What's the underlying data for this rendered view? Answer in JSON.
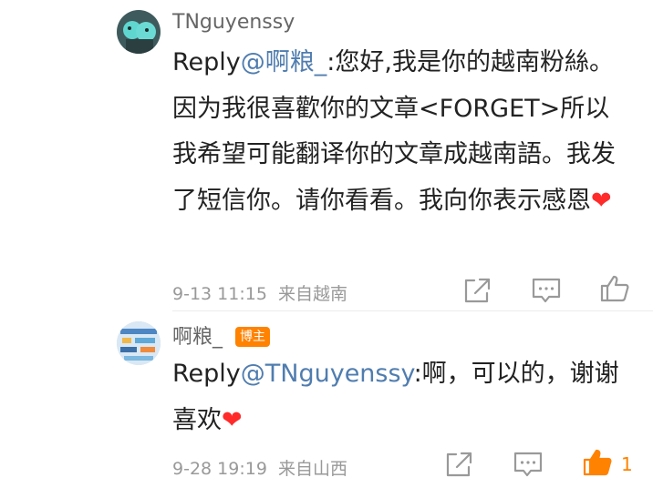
{
  "comments": [
    {
      "username": "TNguyenssy",
      "reply_prefix": "Reply",
      "mention": "@啊粮_",
      "text": ":您好,我是你的越南粉絲。因为我很喜歡你的文章<FORGET>所以我希望可能翻译你的文章成越南語。我发了短信你。请你看看。我向你表示感恩",
      "emoji": "❤",
      "timestamp": "9-13 11:15",
      "location": "来自越南",
      "badge": "",
      "like_count": ""
    },
    {
      "username": "啊粮_",
      "reply_prefix": "Reply",
      "mention": "@TNguyenssy",
      "text": ":啊，可以的，谢谢喜欢",
      "emoji": "❤",
      "timestamp": "9-28 19:19",
      "location": "来自山西",
      "badge": "博主",
      "like_count": "1"
    }
  ],
  "icons": {
    "share": "share-icon",
    "comment": "comment-icon",
    "like": "like-icon"
  },
  "colors": {
    "mention": "#507daf",
    "badge": "#ff8200",
    "like_active": "#ff8200",
    "heart": "#ff2b2b",
    "meta": "#999999"
  }
}
